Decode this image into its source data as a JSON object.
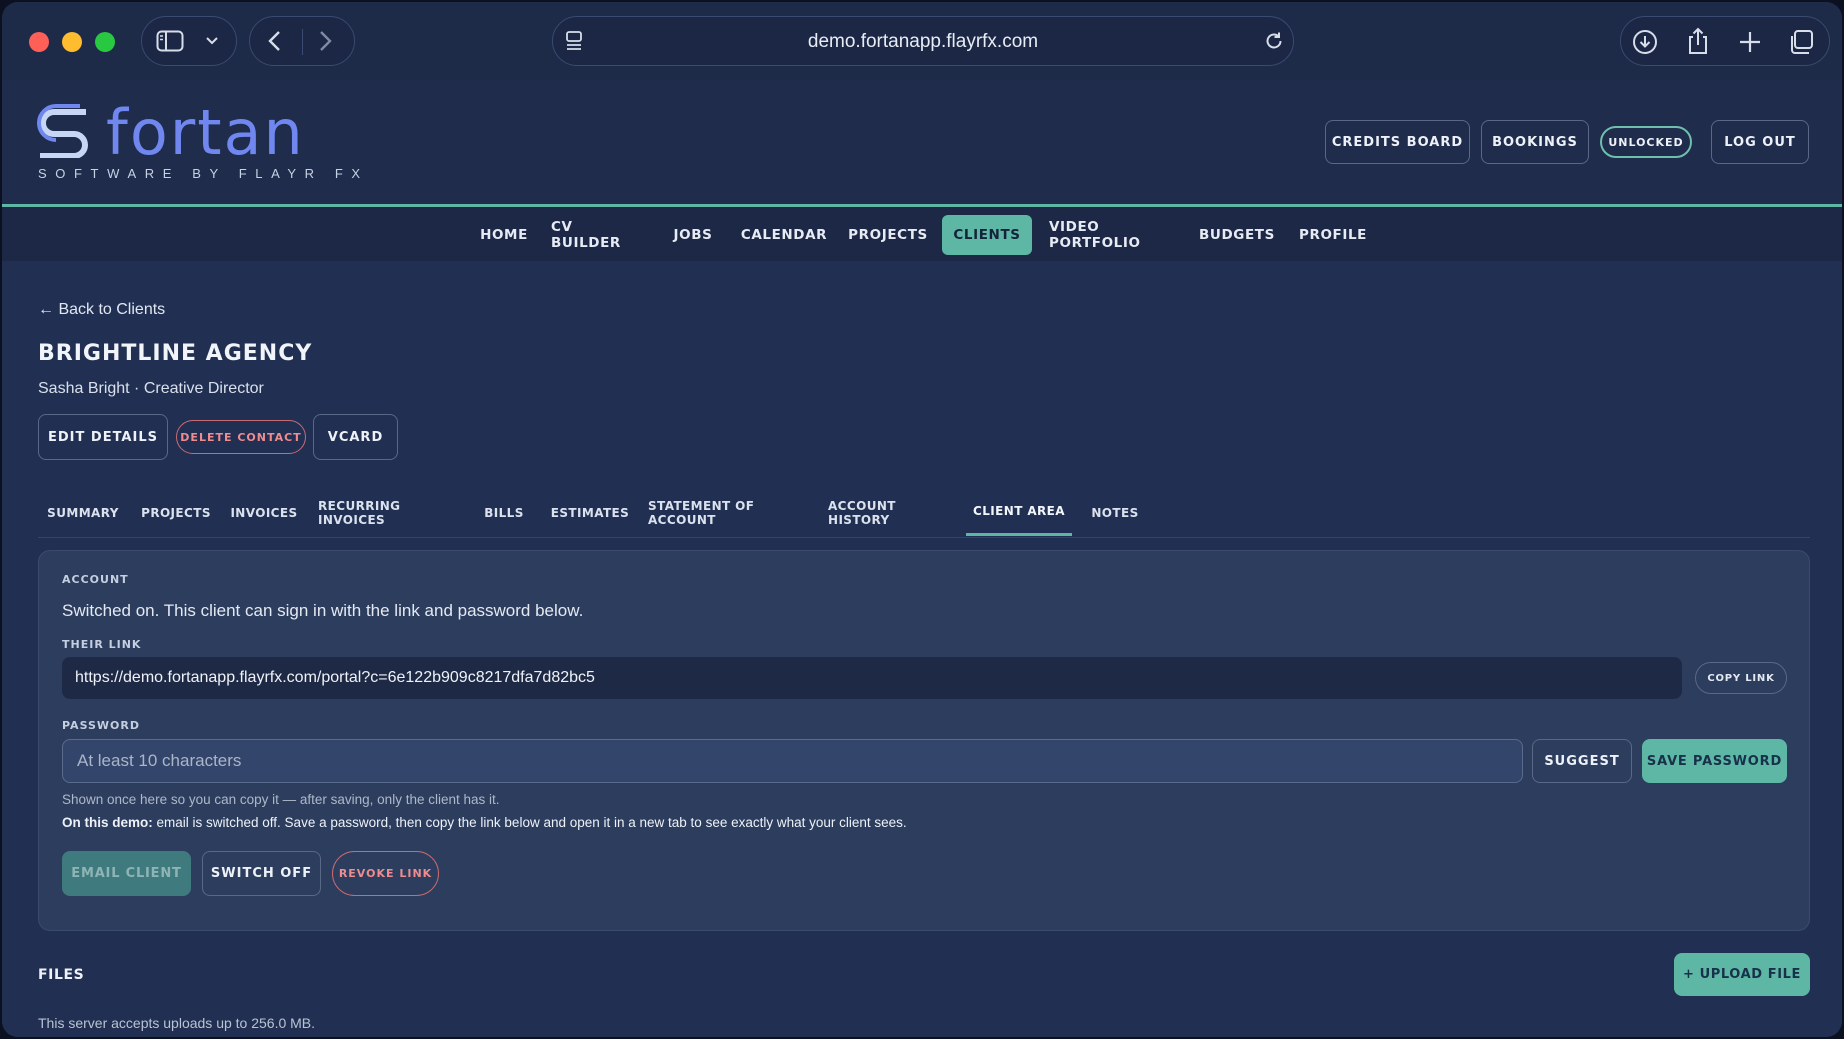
{
  "browser": {
    "url": "demo.fortanapp.flayrfx.com"
  },
  "brand": {
    "name": "fortan",
    "tagline": "SOFTWARE BY FLAYR FX",
    "color": "#6f87ee"
  },
  "header": {
    "buttons": [
      "CREDITS BOARD",
      "BOOKINGS",
      "UNLOCKED",
      "LOG OUT"
    ]
  },
  "nav": {
    "items": [
      "HOME",
      "CV BUILDER",
      "JOBS",
      "CALENDAR",
      "PROJECTS",
      "CLIENTS",
      "VIDEO PORTFOLIO",
      "BUDGETS",
      "PROFILE"
    ],
    "active": "CLIENTS"
  },
  "client": {
    "back_label": "← Back to Clients",
    "name": "BRIGHTLINE AGENCY",
    "subtitle": "Sasha Bright · Creative Director",
    "actions": [
      "EDIT DETAILS",
      "DELETE CONTACT",
      "VCARD"
    ]
  },
  "tabs": {
    "items": [
      "SUMMARY",
      "PROJECTS",
      "INVOICES",
      "RECURRING INVOICES",
      "BILLS",
      "ESTIMATES",
      "STATEMENT OF ACCOUNT",
      "ACCOUNT HISTORY",
      "CLIENT AREA",
      "NOTES"
    ],
    "active": "CLIENT AREA"
  },
  "client_area": {
    "account_label": "ACCOUNT",
    "account_status": "Switched on. This client can sign in with the link and password below.",
    "link_label": "THEIR LINK",
    "link_value": "https://demo.fortanapp.flayrfx.com/portal?c=6e122b909c8217dfa7d82bc5",
    "copy_link_label": "COPY LINK",
    "password_label": "PASSWORD",
    "password_placeholder": "At least 10 characters",
    "suggest_label": "SUGGEST",
    "save_password_label": "SAVE PASSWORD",
    "hint": "Shown once here so you can copy it — after saving, only the client has it.",
    "demo_note_bold": "On this demo:",
    "demo_note_rest": " email is switched off. Save a password, then copy the link below and open it in a new tab to see exactly what your client sees.",
    "email_client_label": "EMAIL CLIENT",
    "switch_off_label": "SWITCH OFF",
    "revoke_link_label": "REVOKE LINK"
  },
  "files": {
    "title": "FILES",
    "upload_label": "+ UPLOAD FILE",
    "note": "This server accepts uploads up to 256.0 MB."
  },
  "colors": {
    "accent": "#5eb7a5",
    "danger": "#ee8c8f",
    "background": "#213052"
  }
}
